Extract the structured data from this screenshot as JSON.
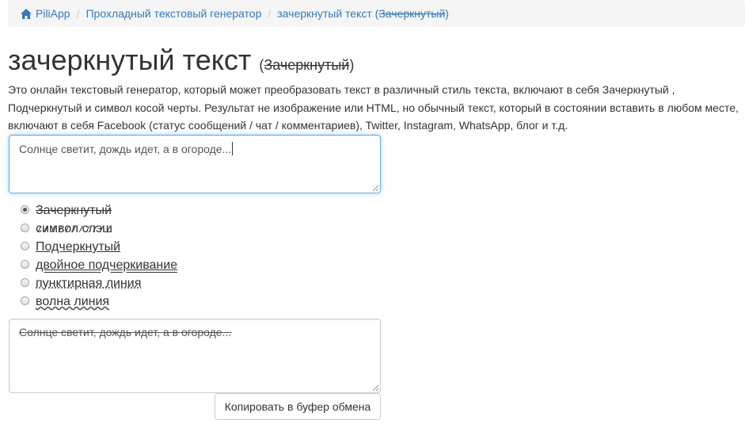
{
  "breadcrumb": {
    "home_label": "PiliApp",
    "separator": "/",
    "item_2": "Прохладный текстовый генератор",
    "item_3_text": "зачеркнутый текст (",
    "item_3_strike": "Зачеркнутый",
    "item_3_close": ")"
  },
  "page": {
    "title": "зачеркнутый текст",
    "subtitle_open": "(",
    "subtitle_strike": "Зачеркнутый",
    "subtitle_close": ")",
    "description": "Это онлайн текстовый генератор, который может преобразовать текст в различный стиль текста, включают в себя Зачеркнутый , Подчеркнутый и символ косой черты. Результат не изображение или HTML, но обычный текст, который в состоянии вставить в любом месте, включают в себя Facebook (статус сообщений / чат / комментариев), Twitter, Instagram, WhatsApp, блог и т.д."
  },
  "input": {
    "value": "Солнце светит, дождь идет, а в огороде..."
  },
  "options": [
    {
      "label": "Зачеркнутый",
      "checked": true
    },
    {
      "label": "символ слэш",
      "checked": false
    },
    {
      "label": "Подчеркнутый",
      "checked": false
    },
    {
      "label": "двойное подчеркивание",
      "checked": false
    },
    {
      "label": "пунктирная линия",
      "checked": false
    },
    {
      "label": "волна линия",
      "checked": false
    }
  ],
  "output": {
    "value": "Солнце светит, дождь идет, а в огороде..."
  },
  "copy_button_label": "Копировать в буфер обмена",
  "colors": {
    "link": "#337ab7",
    "breadcrumb_bg": "#f5f5f5",
    "focus_border": "#66afe9"
  },
  "icons": {
    "home": "home-icon"
  }
}
